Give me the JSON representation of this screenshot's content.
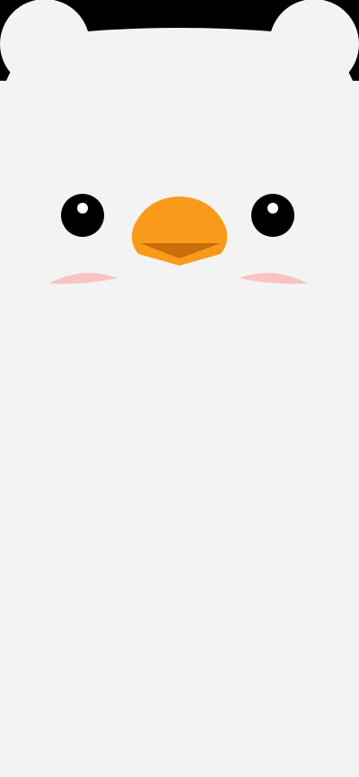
{
  "colors": {
    "background_top": "#000000",
    "body_fill": "#f3f3f3",
    "eye": "#000000",
    "eye_highlight": "#ffffff",
    "beak": "#fa9a1a",
    "beak_shadow": "#c86e0c",
    "blush": "#f8c3c3"
  },
  "character": {
    "type": "cartoon-duck-face",
    "parts": [
      "left-ear",
      "right-ear",
      "left-eye",
      "right-eye",
      "beak",
      "left-cheek",
      "right-cheek"
    ]
  }
}
